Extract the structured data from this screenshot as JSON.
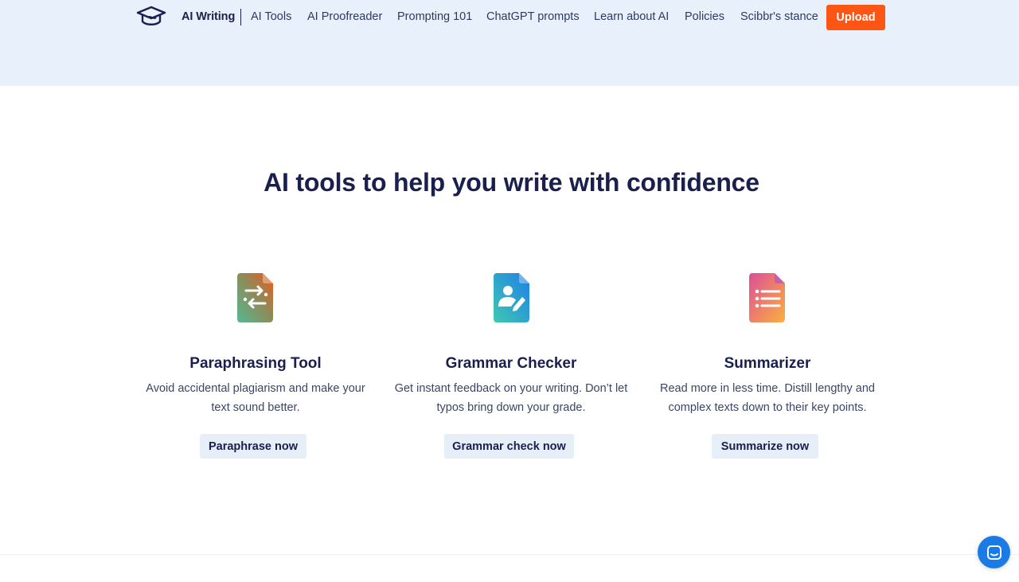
{
  "nav": {
    "brand": "AI Writing",
    "items": [
      {
        "label": "AI Tools"
      },
      {
        "label": "AI Proofreader"
      },
      {
        "label": "Prompting 101"
      },
      {
        "label": "ChatGPT prompts"
      },
      {
        "label": "Learn about AI"
      },
      {
        "label": "Policies"
      },
      {
        "label": "Scibbr's stance"
      }
    ],
    "upload_label": "Upload"
  },
  "section": {
    "title": "AI tools to help you write with confidence"
  },
  "tools": [
    {
      "title": "Paraphrasing Tool",
      "desc_line1": "Avoid accidental plagiarism and make your",
      "desc_line2": "text sound better.",
      "button": "Paraphrase now",
      "icon": "paraphrase-icon"
    },
    {
      "title": "Grammar Checker",
      "desc_line1": "Get instant feedback on your writing. Don’t let",
      "desc_line2": "typos bring down your grade.",
      "button": "Grammar check now",
      "icon": "grammar-icon"
    },
    {
      "title": "Summarizer",
      "desc_line1": "Read more in less time. Distill lengthy and",
      "desc_line2": "complex texts down to their key points.",
      "button": "Summarize now",
      "icon": "summarizer-icon"
    }
  ],
  "colors": {
    "brand_navy": "#1a1f4d",
    "upload_orange": "#fd5614",
    "hero_background": "#e8f1fb",
    "button_background": "#e6eef8",
    "chat_blue": "#1b7be6"
  }
}
